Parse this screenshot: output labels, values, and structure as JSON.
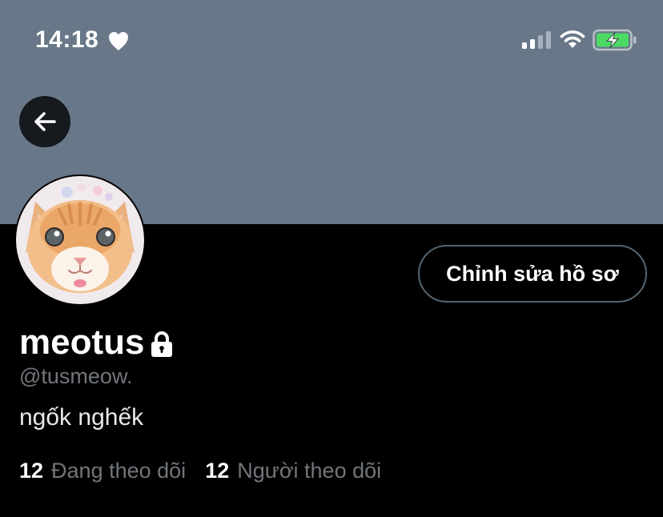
{
  "status_bar": {
    "time": "14:18"
  },
  "header": {
    "banner_color": "#687889",
    "back_icon": "arrow-left-icon"
  },
  "profile": {
    "avatar": "orange-kitten-avatar",
    "edit_button_label": "Chỉnh sửa hồ sơ",
    "display_name": "meotus",
    "handle": "@tusmeow.",
    "bio": "ngốk nghếk",
    "following_count": "12",
    "following_label": "Đang theo dõi",
    "followers_count": "12",
    "followers_label": "Người theo dõi"
  },
  "colors": {
    "background": "#000000",
    "text_primary": "#ffffff",
    "text_secondary": "#71767b",
    "button_border": "#536471",
    "battery_fill": "#4cd964"
  }
}
